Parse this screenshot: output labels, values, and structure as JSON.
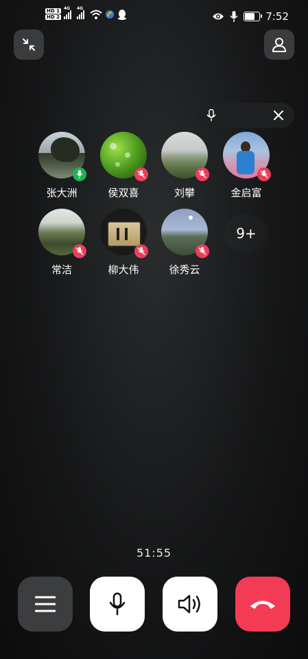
{
  "status_bar": {
    "time": "7:52",
    "left_icons": [
      "hd-1-icon",
      "hd-2-icon",
      "signal-4g-1-icon",
      "signal-4g-2-icon",
      "wifi-icon",
      "app-notification-icon",
      "qq-icon"
    ],
    "right_icons": [
      "eye-icon",
      "microphone-in-use-icon",
      "battery-icon"
    ],
    "battery_level": 0.6,
    "hd_labels": [
      "HD 1",
      "HD 2"
    ],
    "network_labels": [
      "4G",
      "4G"
    ]
  },
  "header": {
    "minimize_icon": "minimize-arrows-icon",
    "contact_icon": "person-icon"
  },
  "mute_all": {
    "mic_icon": "microphone-icon",
    "close_icon": "close-icon"
  },
  "participants": [
    {
      "name": "张大洲",
      "mic": "on"
    },
    {
      "name": "侯双喜",
      "mic": "off"
    },
    {
      "name": "刘攀",
      "mic": "off"
    },
    {
      "name": "金启富",
      "mic": "off"
    },
    {
      "name": "常洁",
      "mic": "off"
    },
    {
      "name": "柳大伟",
      "mic": "off"
    },
    {
      "name": "徐秀云",
      "mic": "off"
    }
  ],
  "more_participants": "9+",
  "call_timer": "51:55",
  "controls": {
    "menu_icon": "menu-icon",
    "mic_icon": "microphone-icon",
    "speaker_icon": "speaker-icon",
    "hangup_icon": "hang-up-icon"
  },
  "colors": {
    "mic_on": "#1fb255",
    "mic_off": "#ee3d5a",
    "hangup": "#f33b55",
    "button_dark": "#3b3d3e"
  }
}
